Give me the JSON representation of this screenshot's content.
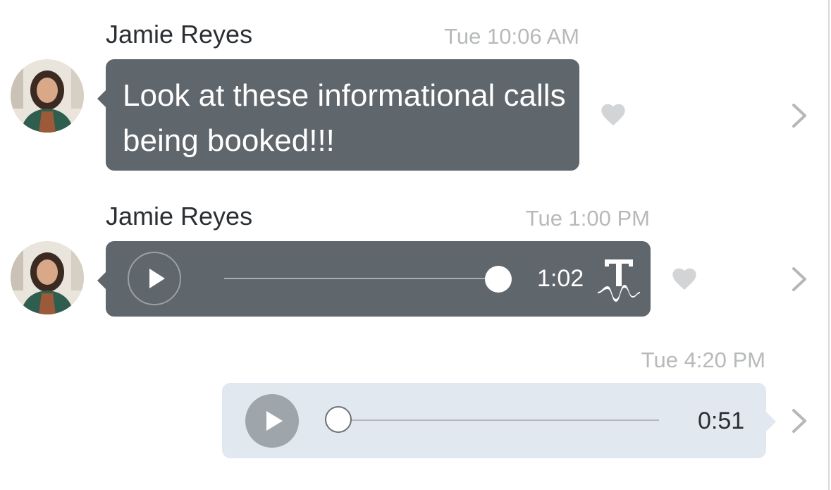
{
  "messages": [
    {
      "sender": "Jamie Reyes",
      "time": "Tue 10:06 AM",
      "text": "Look at these informational calls being booked!!!"
    },
    {
      "sender": "Jamie Reyes",
      "time": "Tue 1:00 PM",
      "audio": {
        "duration": "1:02",
        "progress": 1.0
      }
    },
    {
      "time": "Tue 4:20 PM",
      "audio": {
        "duration": "0:51",
        "progress": 0.0
      }
    }
  ],
  "icons": {
    "avatar": "avatar-photo",
    "like": "heart-icon",
    "more": "chevron-right-icon",
    "play": "play-icon",
    "transcribe": "transcribe-icon"
  },
  "colors": {
    "incoming_bubble": "#5f666c",
    "outgoing_bubble": "#e1e8f0",
    "heart": "#d2d4d6",
    "chevron": "#b5b8bb",
    "timestamp": "#b7b9bb"
  }
}
